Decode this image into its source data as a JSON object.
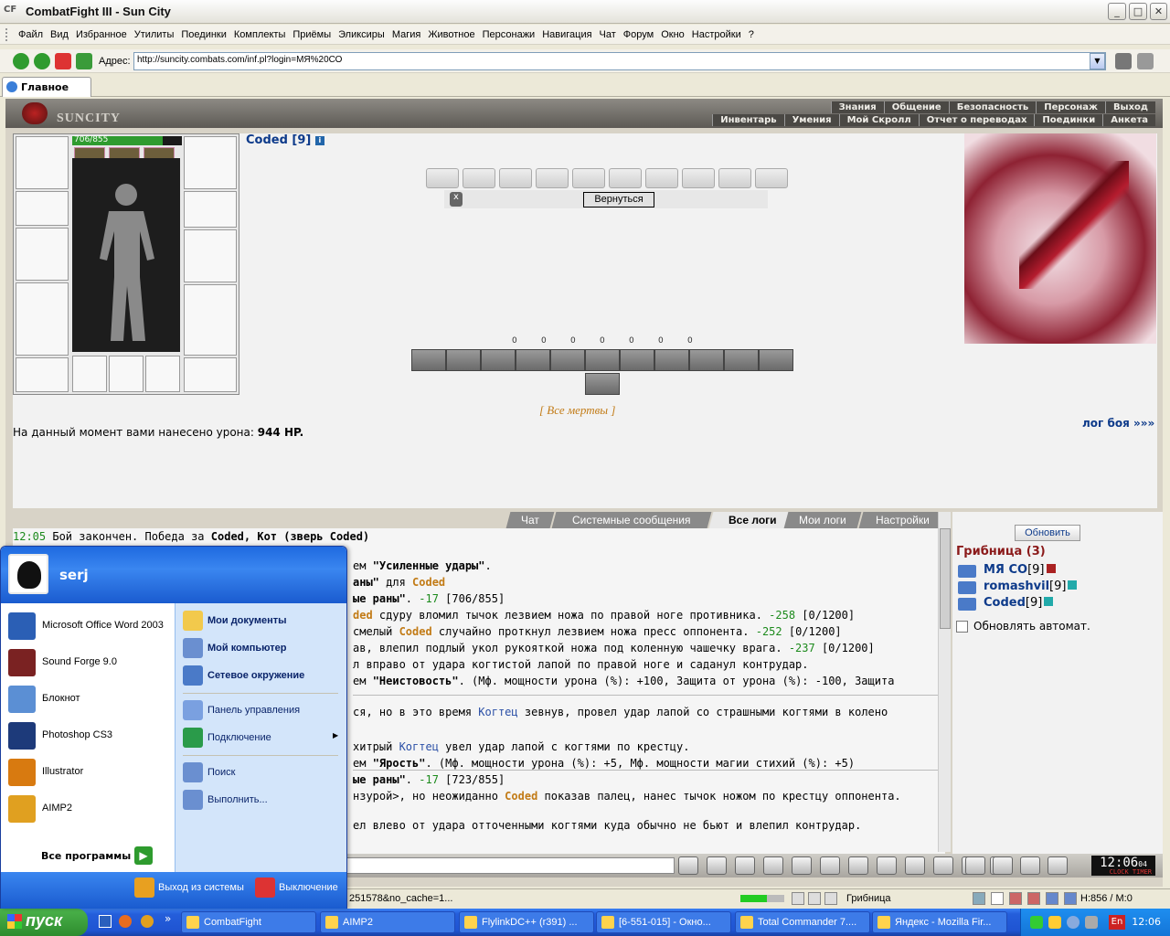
{
  "window": {
    "title": "CombatFight III - Sun City",
    "logo": "CF"
  },
  "menu": [
    "Файл",
    "Вид",
    "Избранное",
    "Утилиты",
    "Поединки",
    "Комплекты",
    "Приёмы",
    "Эликсиры",
    "Магия",
    "Животное",
    "Персонажи",
    "Навигация",
    "Чат",
    "Форум",
    "Окно",
    "Настройки",
    "?"
  ],
  "address": {
    "label": "Адрес:",
    "value": "http://suncity.combats.com/inf.pl?login=МЯ%20СО"
  },
  "tab": {
    "label": "Главное"
  },
  "game": {
    "brand": "SUNCITY",
    "nav_top": [
      "Знания",
      "Общение",
      "Безопасность",
      "Персонаж",
      "Выход"
    ],
    "nav_bottom": [
      "Инвентарь",
      "Умения",
      "Мой Скролл",
      "Отчет о переводах",
      "Поединки",
      "Анкета"
    ],
    "hp": "706/855",
    "hp_fraction": 0.826,
    "char_name": "Coded [9]",
    "info_icon": "i",
    "back_button": "Вернуться",
    "xbadge": "x",
    "stats": [
      "0",
      "0",
      "0",
      "0",
      "0",
      "0",
      "0"
    ],
    "all_dead": "[ Все мертвы ]",
    "damage_prefix": "На данный момент вами нанесено урона:",
    "damage_value": "944 HP.",
    "battle_log": "лог боя »»»"
  },
  "log": {
    "tabs": [
      "Чат",
      "Системные сообщения",
      "Все логи",
      "Мои логи",
      "Настройки"
    ],
    "active_tab": "Все логи",
    "lines": [
      {
        "time": "12:05",
        "text": "Бой закончен. Победа за",
        "hl": "Coded, Кот (зверь Coded)"
      },
      {
        "pre": "ем ",
        "hl": "\"Усиленные удары\"",
        "post": "."
      },
      {
        "hl": "аны\"",
        "post": " для ",
        "name": "Coded"
      },
      {
        "hl": "ые раны\"",
        "post": ". ",
        "dmg": "-17",
        "tail": " [706/855]"
      },
      {
        "name": "ded",
        "post": " сдуру вломил тычок лезвием ножа по правой ноге противника. ",
        "dmg": "-258",
        "tail": " [0/1200]"
      },
      {
        "pre": "смелый ",
        "name": "Coded",
        "post": " случайно проткнул лезвием ножа пресс оппонента. ",
        "dmg": "-252",
        "tail": " [0/1200]"
      },
      {
        "pre": "ав, влепил подлый укол рукояткой ножа под коленную чашечку врага. ",
        "dmg": "-237",
        "tail": " [0/1200]"
      },
      {
        "pre": "л вправо от удара когтистой лапой по правой ноге и саданул контрудар."
      },
      {
        "pre": "ем ",
        "hl": "\"Неистовость\"",
        "post": ". (Мф. мощности урона (%): +100, Защита от урона (%): -100, Защита"
      },
      {
        "pre": "ся, но в это время ",
        "blue": "Когтец",
        "post": " зевнув, провел удар лапой со страшными когтями в колено"
      },
      {
        "pre": " хитрый ",
        "blue": "Когтец",
        "post": " увел удар лапой с когтями по крестцу."
      },
      {
        "pre": "ем ",
        "hl": "\"Ярость\"",
        "post": ". (Мф. мощности урона (%): +5, Мф. мощности магии стихий (%): +5)"
      },
      {
        "hl": "ые раны\"",
        "post": ". ",
        "dmg": "-17",
        "tail": " [723/855]"
      },
      {
        "pre": "нзурой>, но неожиданно ",
        "name": "Coded",
        "post": " показав палец, нанес тычок ножом по крестцу оппонента."
      },
      {
        "pre": "ел влево от удара отточенными когтями куда обычно не бьют и влепил контрудар."
      }
    ]
  },
  "side": {
    "refresh": "Обновить",
    "location": "Грибница (3)",
    "users": [
      {
        "name": "МЯ СО",
        "level": "[9]"
      },
      {
        "name": "romashvil",
        "level": "[9]"
      },
      {
        "name": "Coded",
        "level": "[9]"
      }
    ],
    "auto_refresh": "Обновлять автомат."
  },
  "clock": {
    "time": "12:06",
    "seconds": "04",
    "label": "CLOCK TIMER"
  },
  "statusbar": {
    "url": "251578&no_cache=1...",
    "location": "Грибница",
    "hp": "H:856 / M:0"
  },
  "startmenu": {
    "user": "serj",
    "pinned": [
      {
        "label": "Microsoft Office Word 2003",
        "color": "#2b5fb5"
      },
      {
        "label": "Sound Forge 9.0",
        "color": "#7a2222"
      },
      {
        "label": "Блокнот",
        "color": "#5b8fd4"
      },
      {
        "label": "Photoshop CS3",
        "color": "#1d3a7a"
      },
      {
        "label": "Illustrator",
        "color": "#d87a10"
      },
      {
        "label": "AIMP2",
        "color": "#e0a020"
      }
    ],
    "all_programs": "Все программы",
    "right": [
      {
        "label": "Мои документы",
        "bold": true,
        "color": "#f2c94c"
      },
      {
        "label": "Мой компьютер",
        "bold": true,
        "color": "#6a8fd0"
      },
      {
        "label": "Сетевое окружение",
        "bold": true,
        "color": "#4a7ac8"
      },
      {
        "label": "Панель управления",
        "bold": false,
        "color": "#7aa0e0"
      },
      {
        "label": "Подключение",
        "bold": false,
        "color": "#2a9b4a"
      },
      {
        "label": "Поиск",
        "bold": false,
        "color": "#6a8fd0"
      },
      {
        "label": "Выполнить...",
        "bold": false,
        "color": "#6a8fd0"
      }
    ],
    "logoff": "Выход из системы",
    "shutdown": "Выключение"
  },
  "taskbar": {
    "start": "пуск",
    "items": [
      "CombatFight",
      "AIMP2",
      "FlylinkDC++ (r391) ...",
      "[6-551-015] - Окно...",
      "Total Commander 7....",
      "Яндекс - Mozilla Fir..."
    ],
    "time": "12:06",
    "lang": "En"
  }
}
